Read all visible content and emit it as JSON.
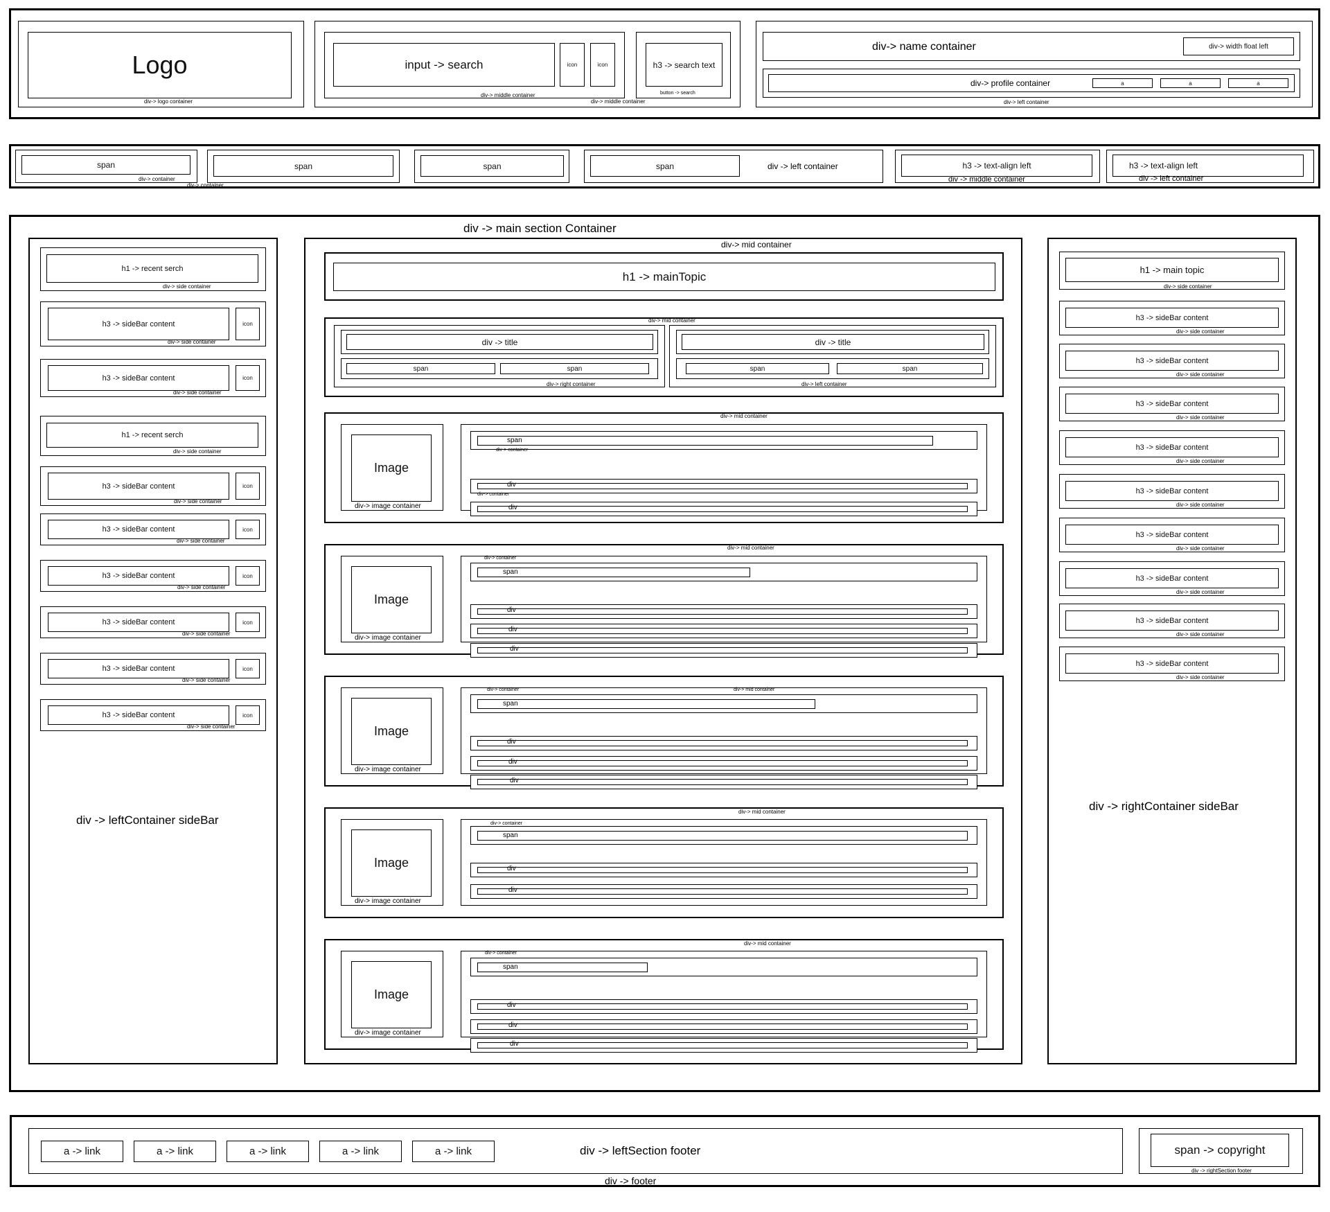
{
  "header": {
    "logo_text": "Logo",
    "logo_container_label": "div-> logo container",
    "search_input_label": "input -> search",
    "icon_a": "icon",
    "icon_b": "icon",
    "middle_container_label": "div-> middle container",
    "middle_container_outer_label": "div-> middle container",
    "search_button_text": "h3 -> search text",
    "search_button_caption": "button -> search",
    "name_container_label": "div-> name container",
    "width_float_left": "div-> width float left",
    "profile_container_label": "div-> profile container",
    "profile_links": [
      "a",
      "a",
      "a"
    ],
    "left_container_label": "div-> left container"
  },
  "nav": {
    "span_labels": [
      "span",
      "span",
      "span",
      "span"
    ],
    "container_caption_1": "div-> container",
    "container_caption_2": "div-> container",
    "left_container_label": "div -> left container",
    "h3_left_1": "h3 -> text-align left",
    "middle_container_label": "div -> middle container",
    "h3_left_2": "h3 -> text-align left",
    "left_container_caption": "div -> left container"
  },
  "main": {
    "title": "div -> main section Container",
    "left_sidebar": {
      "label": "div -> leftContainer sideBar",
      "recent_search_1": "h1 -> recent serch",
      "recent_search_2": "h1 -> recent serch",
      "side_caption": "div-> side container",
      "item_text": "h3 -> sideBar content",
      "icon": "icon"
    },
    "mid": {
      "label": "div-> mid container",
      "main_topic": "h1 -> mainTopic",
      "titles_caption": "div-> mid container",
      "div_title": "div -> title",
      "span": "span",
      "right_container": "div-> right container",
      "left_container": "div-> left container",
      "image": "Image",
      "image_container": "div-> image container",
      "container": "div-> container",
      "div": "div",
      "mid_container": "div-> mid container"
    },
    "right_sidebar": {
      "label": "div -> rightContainer sideBar",
      "main_topic": "h1 -> main topic",
      "item_text": "h3 -> sideBar content",
      "side_caption": "div-> side container"
    }
  },
  "footer": {
    "links": [
      "a -> link",
      "a -> link",
      "a -> link",
      "a -> link",
      "a -> link"
    ],
    "left_section_label": "div -> leftSection footer",
    "copyright": "span -> copyright",
    "right_section_label": "div -> rightSection footer",
    "footer_label": "div -> footer"
  }
}
